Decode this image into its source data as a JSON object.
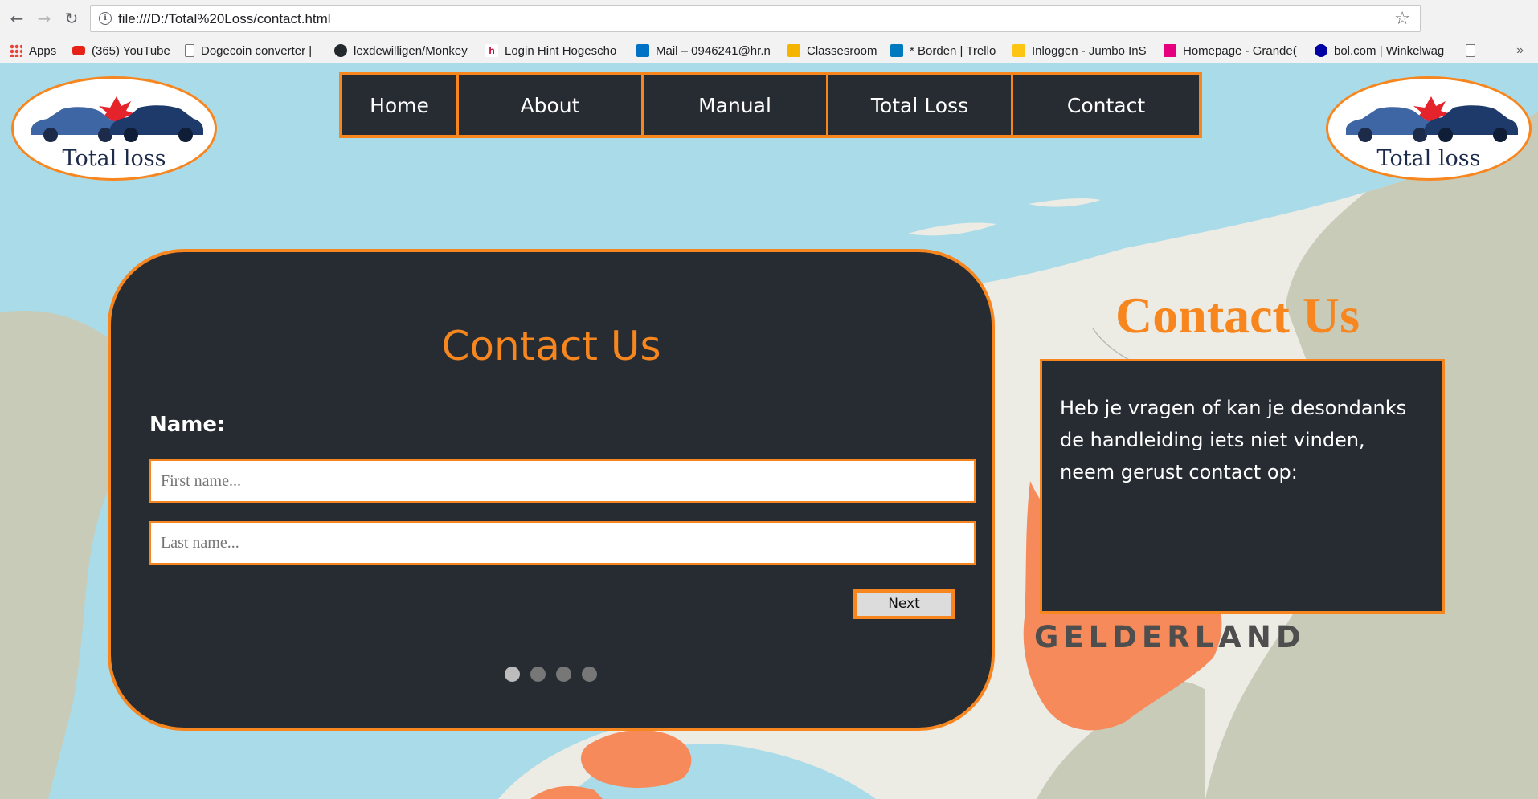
{
  "browser": {
    "url": "file:///D:/Total%20Loss/contact.html",
    "back_icon": "arrow-left-icon",
    "forward_icon": "arrow-right-icon",
    "reload_icon": "reload-icon",
    "bookmark_star_icon": "star-icon"
  },
  "bookmarks": [
    {
      "label": "Apps",
      "icon": "apps-grid-icon"
    },
    {
      "label": "(365) YouTube",
      "icon": "youtube-icon"
    },
    {
      "label": "Dogecoin converter |",
      "icon": "page-icon"
    },
    {
      "label": "lexdewilligen/Monkey",
      "icon": "github-icon"
    },
    {
      "label": "Login Hint Hogescho",
      "icon": "hint-icon"
    },
    {
      "label": "Mail – 0946241@hr.n",
      "icon": "outlook-icon"
    },
    {
      "label": "Classesroom",
      "icon": "classroom-icon"
    },
    {
      "label": "* Borden | Trello",
      "icon": "trello-icon"
    },
    {
      "label": "Inloggen - Jumbo InS",
      "icon": "jumbo-icon"
    },
    {
      "label": "Homepage - Grande(",
      "icon": "grande-icon"
    },
    {
      "label": "bol.com | Winkelwag",
      "icon": "bol-icon"
    },
    {
      "label": "",
      "icon": "page-icon"
    }
  ],
  "bookmarks_more": "»",
  "logo": {
    "text": "Total loss"
  },
  "nav": {
    "items": [
      {
        "label": "Home"
      },
      {
        "label": "About"
      },
      {
        "label": "Manual"
      },
      {
        "label": "Total Loss"
      },
      {
        "label": "Contact"
      }
    ]
  },
  "form": {
    "title": "Contact Us",
    "name_label": "Name:",
    "first_name_placeholder": "First name...",
    "last_name_placeholder": "Last name...",
    "next_label": "Next",
    "steps": 4,
    "active_step": 1
  },
  "sidebar": {
    "title": "Contact Us",
    "text": "Heb je vragen of kan je desondanks de handleiding iets niet vinden, neem gerust contact op:"
  },
  "map": {
    "label": "GELDERLAND",
    "colors": {
      "water": "#aadbe9",
      "land": "#ecebe4",
      "highlight": "#f68a5b",
      "foreign": "#c8cbb8"
    }
  },
  "colors": {
    "accent": "#f7861f",
    "panel": "#272c33"
  }
}
